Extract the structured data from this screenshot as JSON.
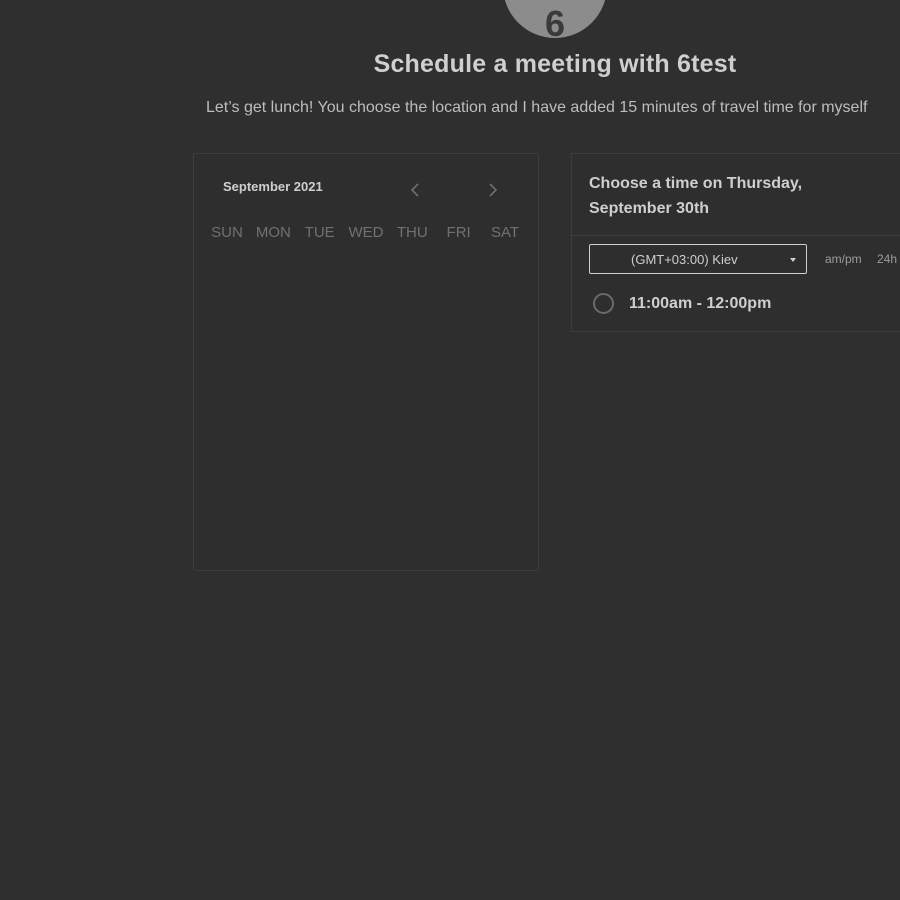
{
  "host": {
    "avatar_initial": "6"
  },
  "header": {
    "title": "Schedule a meeting with 6test",
    "subtitle": "Let’s get lunch! You choose the location and I have added 15 minutes of travel time for myself"
  },
  "calendar": {
    "month_label": "September 2021",
    "prev_icon": "chevron-left-icon",
    "next_icon": "chevron-right-icon",
    "weekdays": [
      "SUN",
      "MON",
      "TUE",
      "WED",
      "THU",
      "FRI",
      "SAT"
    ]
  },
  "times": {
    "heading": "Choose a time on Thursday, September 30th",
    "timezone": "(GMT+03:00) Kiev",
    "format_ampm": "am/pm",
    "format_24h": "24h",
    "slots": [
      {
        "label": "11:00am - 12:00pm",
        "selected": false
      }
    ]
  },
  "colors": {
    "background": "#2f2f2f",
    "text": "#cfcfcf",
    "muted": "#717171",
    "avatar": "#8c8c8c"
  }
}
